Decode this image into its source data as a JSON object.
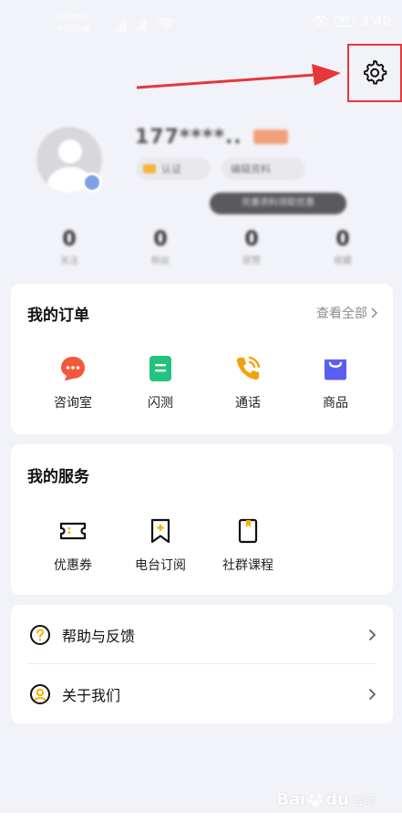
{
  "status_bar": {
    "carrier_line1": "中国移动 ",
    "carrier_line2": "中国联通 ",
    "time": "3:40",
    "battery": "83"
  },
  "profile": {
    "phone": "177****..",
    "pill1": "认证",
    "pill2": "编辑资料",
    "tooltip": "完善资料领取优惠"
  },
  "stats": [
    {
      "value": "0",
      "label": "关注"
    },
    {
      "value": "0",
      "label": "粉丝"
    },
    {
      "value": "0",
      "label": "获赞"
    },
    {
      "value": "0",
      "label": "收藏"
    }
  ],
  "orders": {
    "title": "我的订单",
    "view_all": "查看全部",
    "items": [
      {
        "label": "咨询室",
        "icon": "chat-bubble-icon",
        "color": "#f4583a"
      },
      {
        "label": "闪测",
        "icon": "test-document-icon",
        "color": "#23c27f"
      },
      {
        "label": "通话",
        "icon": "phone-call-icon",
        "color": "#f5a10c"
      },
      {
        "label": "商品",
        "icon": "shopping-bag-icon",
        "color": "#5b5ef0"
      }
    ]
  },
  "services": {
    "title": "我的服务",
    "items": [
      {
        "label": "优惠券",
        "icon": "coupon-icon"
      },
      {
        "label": "电台订阅",
        "icon": "bookmark-add-icon"
      },
      {
        "label": "社群课程",
        "icon": "course-book-icon"
      }
    ]
  },
  "links": [
    {
      "label": "帮助与反馈",
      "icon": "help-circle-icon"
    },
    {
      "label": "关于我们",
      "icon": "about-user-icon"
    }
  ],
  "watermark": {
    "brand": "Bai",
    "brand2": "du",
    "sub": "经验"
  },
  "colors": {
    "background": "#f2f3f8",
    "accent_yellow": "#f5b400",
    "annotation_red": "#e5383b"
  }
}
